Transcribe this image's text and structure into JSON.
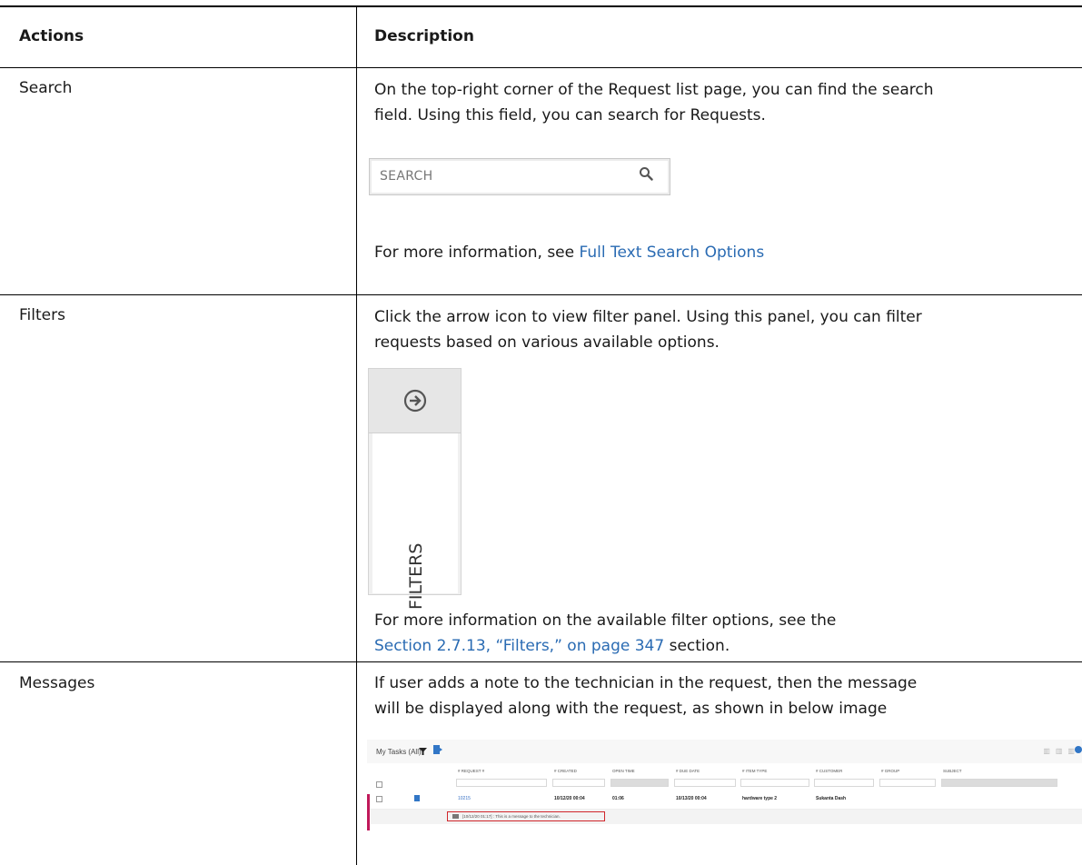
{
  "table": {
    "headers": {
      "actions": "Actions",
      "description": "Description"
    },
    "rows": [
      {
        "action": "Search",
        "desc_lines": [
          "On the top-right corner of the Request list page, you can find the search",
          "field. Using this field, you can search for Requests."
        ],
        "search_placeholder": "SEARCH",
        "more_prefix": "For more information, see ",
        "more_link": "Full Text Search Options"
      },
      {
        "action": "Filters",
        "desc_lines": [
          "Click the arrow icon to view filter panel. Using this panel, you can filter",
          "requests based on various available options."
        ],
        "panel_label": "FILTERS",
        "more_line1": "For more information on the available filter options, see the",
        "more_link": "Section 2.7.13, “Filters,” on page 347",
        "more_suffix": " section."
      },
      {
        "action": "Messages",
        "desc_lines": [
          "If user adds a note to the technician in the request, then the message",
          "will be displayed along with the request, as shown in below image"
        ],
        "screenshot": {
          "title": "My Tasks (All)",
          "columns": [
            "# REQUEST #",
            "# CREATED",
            "OPEN TIME",
            "# DUE DATE",
            "# ITEM TYPE",
            "# CUSTOMER",
            "# GROUP",
            "SUBJECT"
          ],
          "row": {
            "request": "10215",
            "created": "10/12/20 00:04",
            "open_time": "01:06",
            "due_date": "10/13/20 00:04",
            "item_type": "hardware type 2",
            "customer": "Sukanta Dash"
          },
          "message": "[10/12/20 01:17] : This is a message to the technician."
        }
      }
    ]
  },
  "colors": {
    "link": "#2a6bb3",
    "message_border": "#d0262b",
    "priority_bar": "#c0195a"
  }
}
